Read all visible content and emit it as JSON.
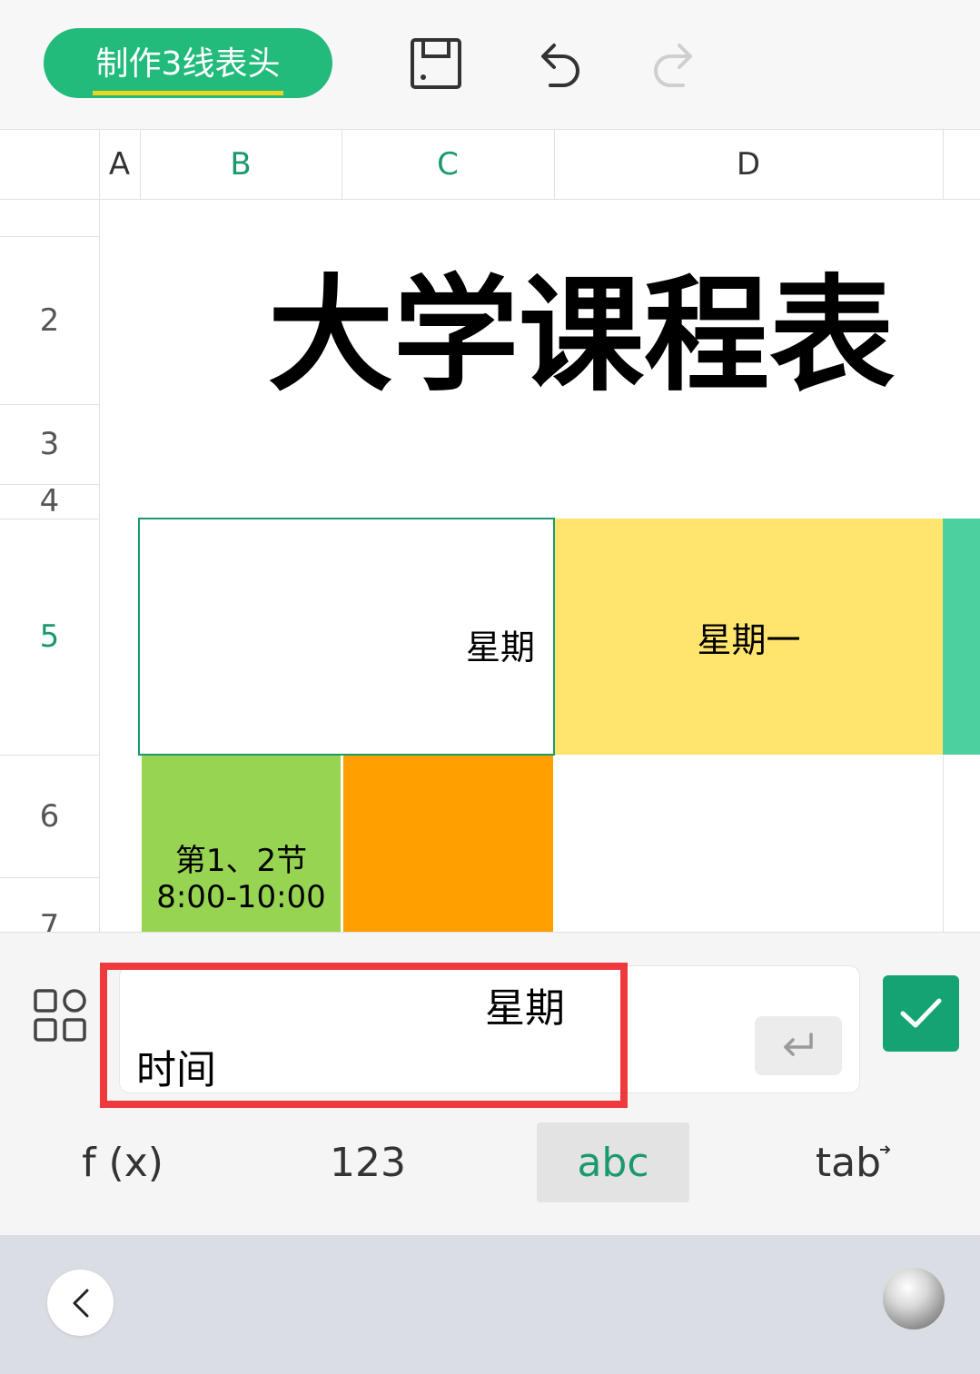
{
  "toolbar": {
    "tutorial_label": "制作3线表头",
    "icons": [
      "save-icon",
      "undo-icon",
      "redo-icon"
    ]
  },
  "sheet": {
    "columns": [
      "A",
      "B",
      "C",
      "D"
    ],
    "active_column": "B",
    "rows": [
      "2",
      "3",
      "4",
      "5",
      "6",
      "7"
    ],
    "active_row": "5",
    "title": "大学课程表",
    "header_cell_text": "星期",
    "monday_label": "星期一",
    "period_label": "第1、2节",
    "period_time": "8:00-10:00",
    "colors": {
      "selected_border": "#1a9a6c",
      "monday_fill": "#ffe46d",
      "next_header_fill": "#4cd09f",
      "period_fill": "#96d452",
      "orange_fill": "#ff9f00"
    }
  },
  "editor": {
    "line1": "星期",
    "line2": "时间"
  },
  "keyboard_tabs": {
    "fx": "f (x)",
    "numbers": "123",
    "letters": "abc",
    "tab": "tab"
  },
  "nav": {
    "back_icon": "chevron-left-icon"
  }
}
